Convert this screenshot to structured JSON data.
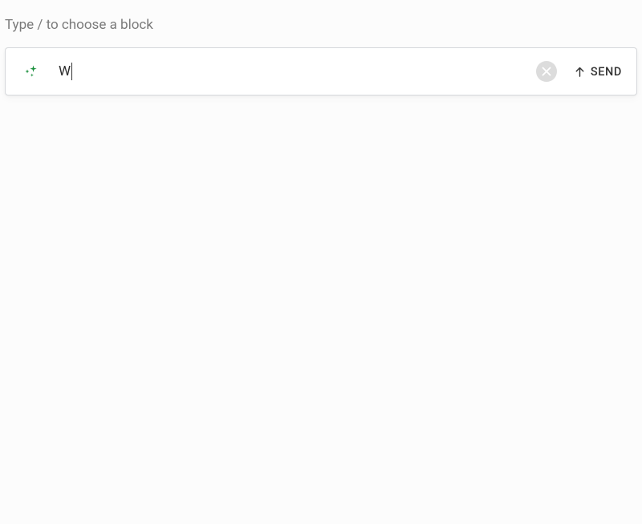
{
  "hint": {
    "text": "Type / to choose a block"
  },
  "input": {
    "value": "W",
    "icon_name": "sparkles-icon"
  },
  "actions": {
    "clear_icon": "close-icon",
    "send_label": "SEND",
    "send_icon": "arrow-up-icon"
  },
  "colors": {
    "accent_green": "#1a8f3c",
    "muted_text": "#7a7a7a",
    "border": "#d6d8db",
    "clear_bg": "#dcdcdc"
  }
}
